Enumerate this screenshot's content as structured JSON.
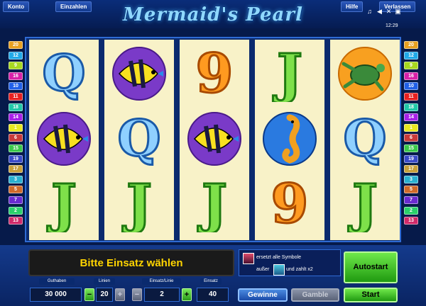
{
  "header": {
    "menu": [
      "Konto",
      "Einzahlen",
      "Hilfe",
      "Verlassen"
    ],
    "title": "Mermaid's Pearl",
    "clock": "12:29",
    "icons": [
      "music-note-icon",
      "speaker-icon",
      "close-icon",
      "fullscreen-icon"
    ]
  },
  "paylines": {
    "left": [
      "20",
      "12",
      "9",
      "16",
      "10",
      "11",
      "18",
      "14",
      "1",
      "6",
      "15",
      "19",
      "17",
      "3",
      "5",
      "7",
      "2",
      "13"
    ],
    "right": [
      "20",
      "12",
      "9",
      "16",
      "10",
      "11",
      "18",
      "14",
      "1",
      "6",
      "15",
      "19",
      "17",
      "3",
      "5",
      "7",
      "2",
      "13"
    ]
  },
  "reels": [
    [
      "q-symbol",
      "angelfish-symbol",
      "j-symbol"
    ],
    [
      "angelfish-symbol",
      "q-symbol",
      "j-symbol"
    ],
    [
      "nine-symbol",
      "angelfish-symbol",
      "j-symbol"
    ],
    [
      "j-symbol",
      "seahorse-symbol",
      "nine-symbol"
    ],
    [
      "turtle-symbol",
      "q-symbol",
      "j-symbol"
    ]
  ],
  "message": "Bitte Einsatz wählen",
  "info": {
    "line1": "ersetzt alle Symbole",
    "line2a": "außer",
    "line2b": "und zahlt x2"
  },
  "controls": {
    "balance_label": "Guthaben",
    "balance": "30 000",
    "lines_label": "Linien",
    "lines": "20",
    "bet_per_line_label": "Einsatz/Linie",
    "bet_per_line": "2",
    "total_bet_label": "Einsatz",
    "total_bet": "40",
    "autostart": "Autostart",
    "start": "Start",
    "gewinne": "Gewinne",
    "gamble": "Gamble",
    "minus": "−",
    "plus": "+"
  }
}
